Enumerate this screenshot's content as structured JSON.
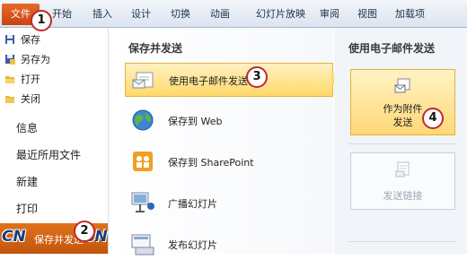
{
  "ribbon": {
    "file_tab": "文件",
    "tabs": [
      "开始",
      "插入",
      "设计",
      "切换",
      "动画",
      "幻灯片放映",
      "审阅",
      "视图",
      "加载项"
    ]
  },
  "left_nav": {
    "small_items": [
      "保存",
      "另存为",
      "打开",
      "关闭"
    ],
    "big_items": [
      "信息",
      "最近所用文件",
      "新建",
      "打印"
    ],
    "active_item": "保存并发送",
    "watermark_left": "CN",
    "watermark_right": "CN"
  },
  "middle": {
    "title": "保存并发送",
    "options": [
      {
        "label": "使用电子邮件发送",
        "icon": "email-icon",
        "selected": true
      },
      {
        "label": "保存到 Web",
        "icon": "globe-icon",
        "selected": false
      },
      {
        "label": "保存到 SharePoint",
        "icon": "sharepoint-icon",
        "selected": false
      },
      {
        "label": "广播幻灯片",
        "icon": "broadcast-icon",
        "selected": false
      },
      {
        "label": "发布幻灯片",
        "icon": "publish-slides-icon",
        "selected": false
      }
    ]
  },
  "right": {
    "title": "使用电子邮件发送",
    "attach_button": {
      "line1": "作为附件",
      "line2": "发送"
    },
    "link_button": {
      "label": "发送链接"
    }
  },
  "callouts": [
    "1",
    "2",
    "3",
    "4"
  ],
  "colors": {
    "file_tab": "#c94410",
    "selection": "#ffd96a",
    "callout_ring": "#c0282d"
  }
}
